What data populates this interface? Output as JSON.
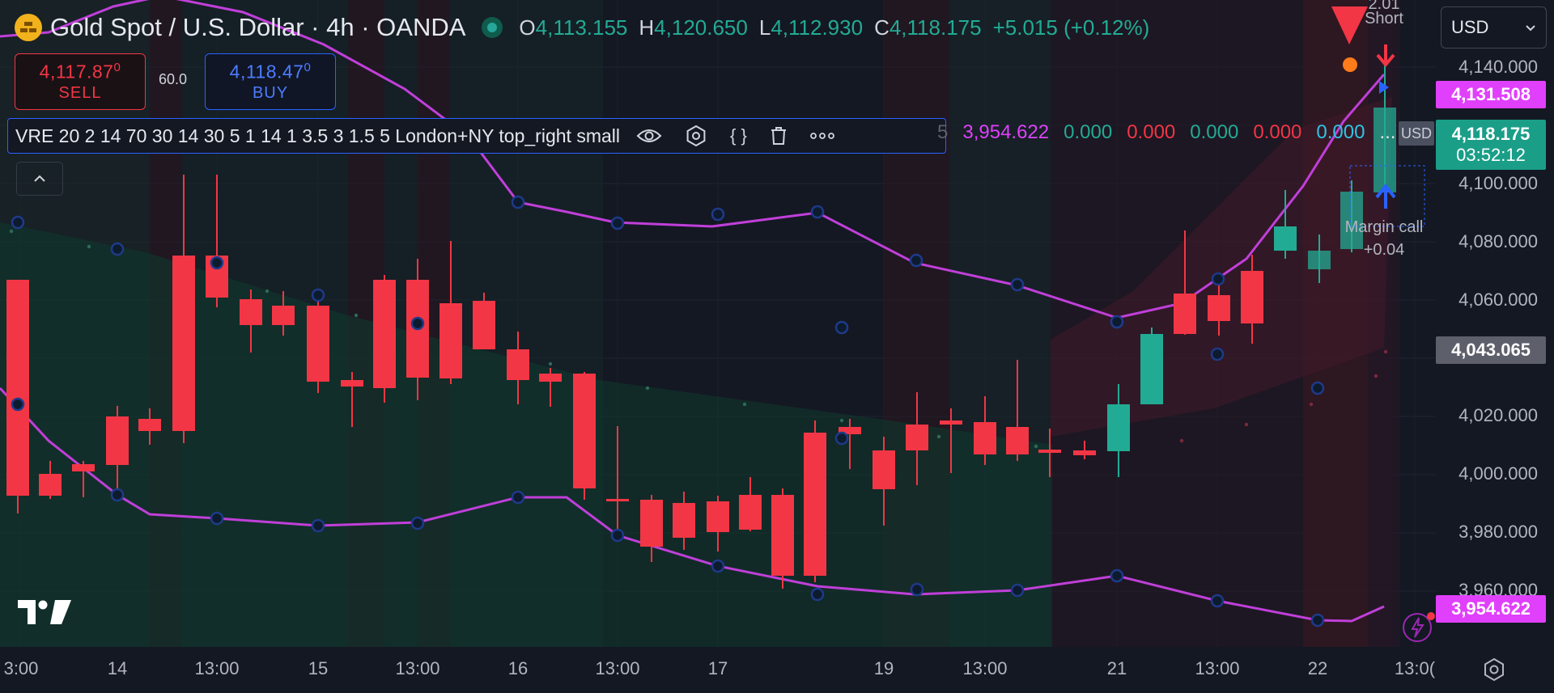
{
  "header": {
    "symbol_title": "Gold Spot / U.S. Dollar · 4h · OANDA",
    "ohlc": [
      {
        "key": "O",
        "value": "4,113.155"
      },
      {
        "key": "H",
        "value": "4,120.650"
      },
      {
        "key": "L",
        "value": "4,112.930"
      },
      {
        "key": "C",
        "value": "4,118.175"
      }
    ],
    "change": "+5.015 (+0.12%)"
  },
  "trade": {
    "sell_price": "4,117.87",
    "sell_price_sup": "0",
    "sell_label": "SELL",
    "spread": "60.0",
    "buy_price": "4,118.47",
    "buy_price_sup": "0",
    "buy_label": "BUY"
  },
  "indicator": {
    "params": "VRE 20 2 14 70 30 14 30 5 1 14 1 3.5 3 1.5 5 London+NY top_right small",
    "clipped_value": "5",
    "values": [
      {
        "text": "3,954.622",
        "color": "#e040fb"
      },
      {
        "text": "0.000",
        "color": "#22ab94"
      },
      {
        "text": "0.000",
        "color": "#f23645"
      },
      {
        "text": "0.000",
        "color": "#22ab94"
      },
      {
        "text": "0.000",
        "color": "#f23645"
      },
      {
        "text": "0.000",
        "color": "#2ec4e6"
      }
    ],
    "overflow": "..."
  },
  "currency_select": {
    "value": "USD"
  },
  "price_axis": {
    "ticks": [
      "4,140.000",
      "4,100.000",
      "4,080.000",
      "4,060.000",
      "4,020.000",
      "4,000.000",
      "3,980.000",
      "3,960.000"
    ],
    "tags": {
      "upper_band": "4,131.508",
      "last_price": "4,118.175",
      "countdown": "03:52:12",
      "mid": "4,043.065",
      "lower_band": "3,954.622",
      "usd_overlay": "USD"
    }
  },
  "time_axis": {
    "ticks": [
      "3:00",
      "14",
      "13:00",
      "15",
      "13:00",
      "16",
      "13:00",
      "17",
      "19",
      "13:00",
      "21",
      "13:00",
      "22",
      "13:0("
    ]
  },
  "signals": {
    "short_label": "Short",
    "short_clipped": "2.01",
    "margin_label": "Margin call",
    "margin_value": "+0.04"
  },
  "colors": {
    "up": "#22ab94",
    "down": "#f23645",
    "band": "#c03fd9",
    "background": "#141823"
  }
}
